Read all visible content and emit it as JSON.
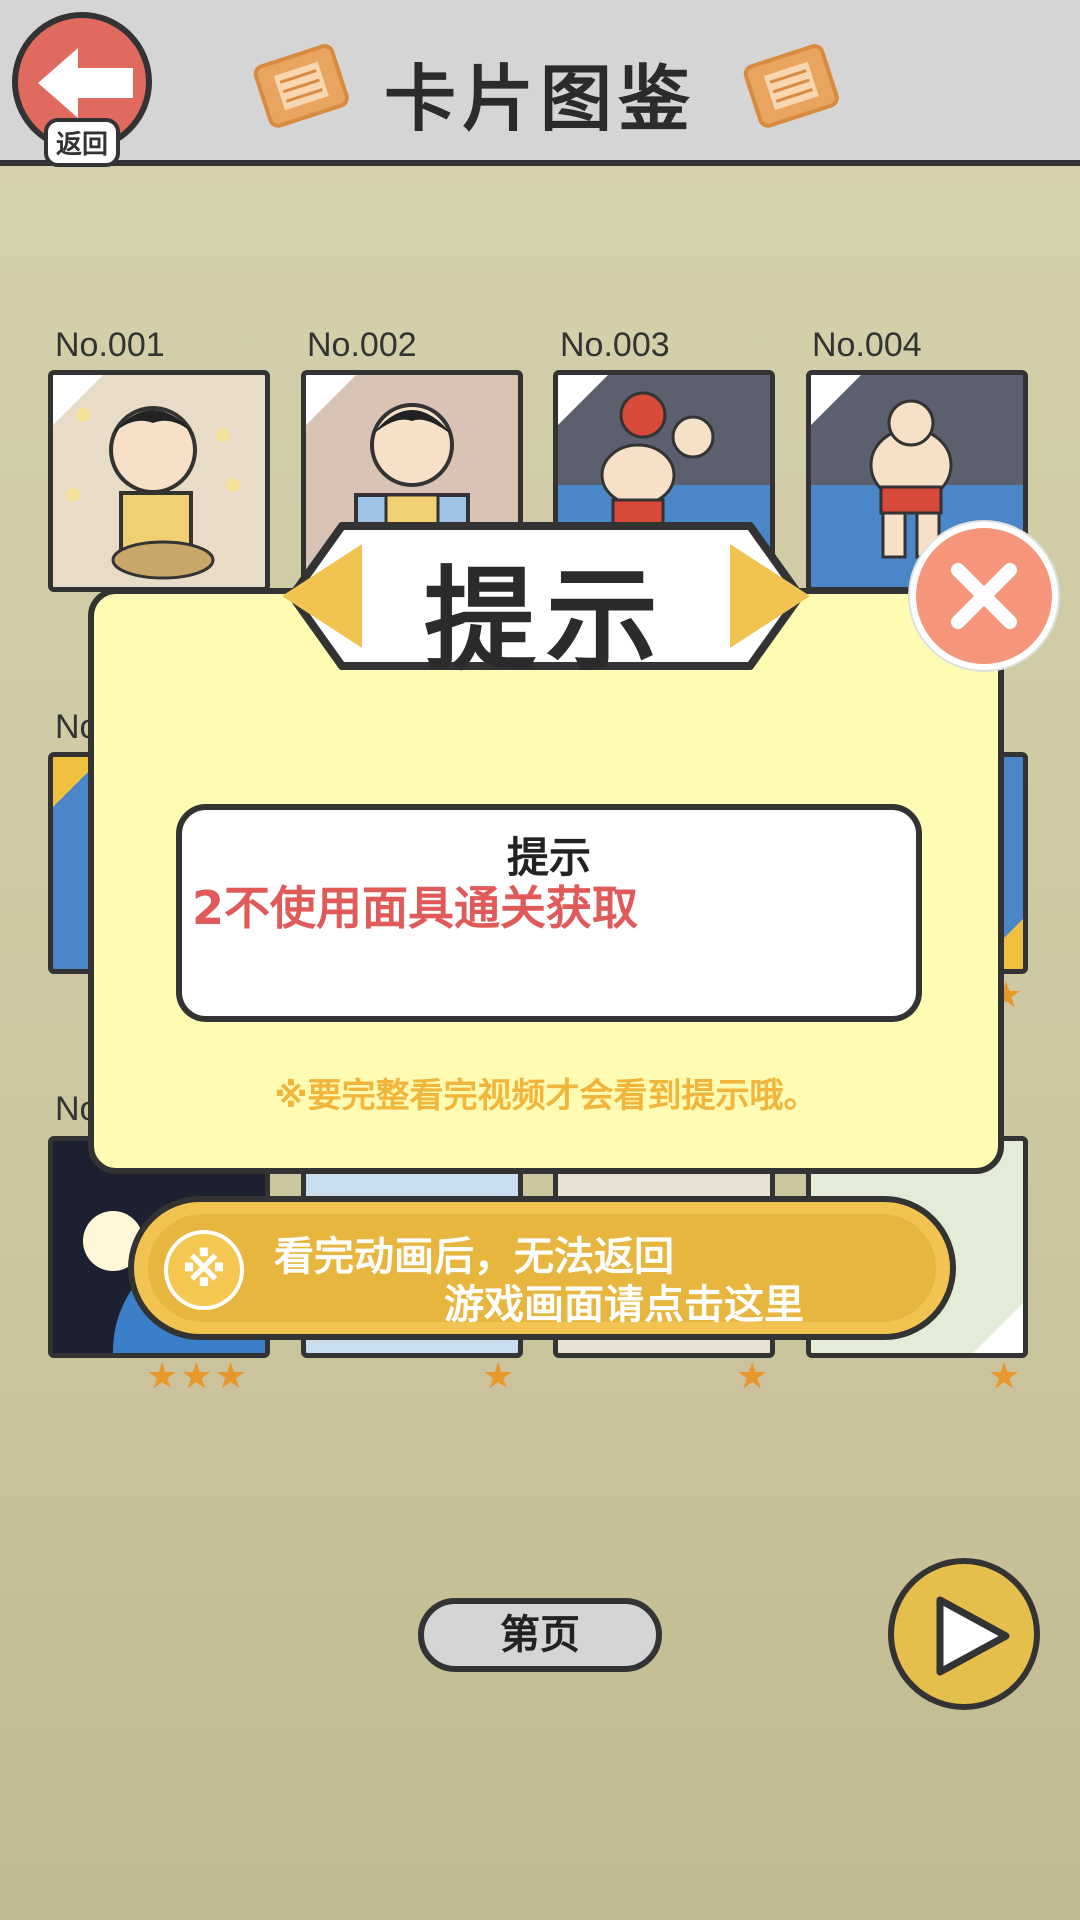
{
  "header": {
    "title": "卡片图鉴",
    "back_label": "返回"
  },
  "cards": [
    {
      "no": "No.001"
    },
    {
      "no": "No.002"
    },
    {
      "no": "No.003"
    },
    {
      "no": "No.004"
    }
  ],
  "row_labels": [
    "No",
    "No"
  ],
  "stars": {
    "row2_right": "★",
    "row3": [
      "★★★",
      "★",
      "★",
      "★"
    ]
  },
  "dialog": {
    "banner_title": "提示",
    "hint_title": "提示",
    "hint_body": "2不使用面具通关获取",
    "note": "※要完整看完视频才会看到提示哦。",
    "watch_button_line1": "看完动画后，无法返回",
    "watch_button_line2": "游戏画面请点击这里",
    "watch_icon": "※"
  },
  "pager": {
    "page_label": "第页"
  },
  "colors": {
    "dialog_bg": "#fffbb2",
    "accent_yellow": "#f1c451",
    "close_red": "#f5957a",
    "hint_red": "#e05a5a",
    "star_orange": "#e8972c"
  }
}
